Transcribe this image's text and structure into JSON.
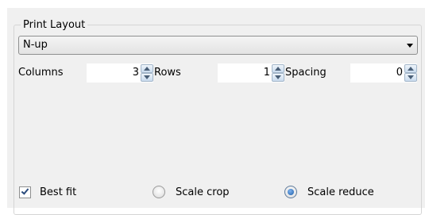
{
  "group": {
    "title": "Print Layout"
  },
  "layout_select": {
    "value": "N-up",
    "icon": "chevron-down-icon"
  },
  "columns": {
    "label": "Columns",
    "value": "3"
  },
  "rows": {
    "label": "Rows",
    "value": "1"
  },
  "spacing": {
    "label": "Spacing",
    "value": "0"
  },
  "options": {
    "best_fit": {
      "label": "Best fit",
      "checked": true
    },
    "scale_crop": {
      "label": "Scale crop",
      "selected": false
    },
    "scale_reduce": {
      "label": "Scale reduce",
      "selected": true
    }
  },
  "colors": {
    "panel": "#f0f0f0",
    "accent": "#1d5ea8"
  }
}
